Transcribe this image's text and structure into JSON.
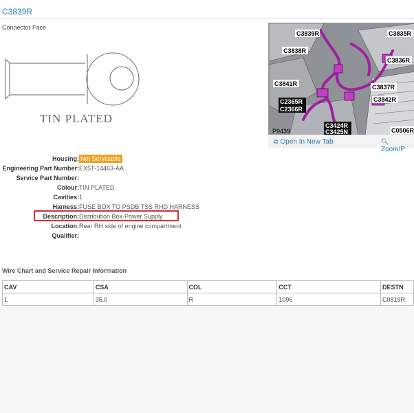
{
  "header": {
    "title": "C3839R"
  },
  "connector_face": {
    "label": "Connector Face",
    "drawing_text": "TIN PLATED"
  },
  "photo": {
    "callouts": [
      "C3839R",
      "C3835R",
      "C3838R",
      "C3836R",
      "C3841R",
      "C3837R",
      "C2365R",
      "C2366R",
      "C3842R",
      "C3424R",
      "C3425N",
      "P9439",
      "C0506R"
    ],
    "open_new_tab": "Open In New Tab",
    "zoom": "Zoom/P"
  },
  "properties": [
    {
      "key": "Housing:",
      "value": "Not Servicable",
      "highlight": true
    },
    {
      "key": "Engineering Part Number:",
      "value": "EX5T-14463-AA"
    },
    {
      "key": "Service Part Number:",
      "value": ""
    },
    {
      "key": "Colour:",
      "value": "TIN PLATED"
    },
    {
      "key": "Cavities:",
      "value": "1"
    },
    {
      "key": "Harness:",
      "value": "FUSE BOX TO PSDB TSS RHD HARNESS"
    },
    {
      "key": "Description:",
      "value": "Distribution Box-Power Supply"
    },
    {
      "key": "Location:",
      "value": "Rear RH side of engine compartment"
    },
    {
      "key": "Qualifier:",
      "value": ""
    }
  ],
  "wire_chart": {
    "heading": "Wire Chart and Service Repair Information",
    "columns": [
      "CAV",
      "CSA",
      "COL",
      "CCT",
      "DESTN"
    ],
    "rows": [
      [
        "1",
        "35.0",
        "R",
        "1096",
        "C0819R"
      ]
    ]
  },
  "colors": {
    "link": "#2a7ab8",
    "highlight": "#f0a020",
    "annotation_box": "#d8303a",
    "harness": "#a020a0"
  },
  "icons": [
    "open-new-tab-icon",
    "zoom-icon"
  ]
}
